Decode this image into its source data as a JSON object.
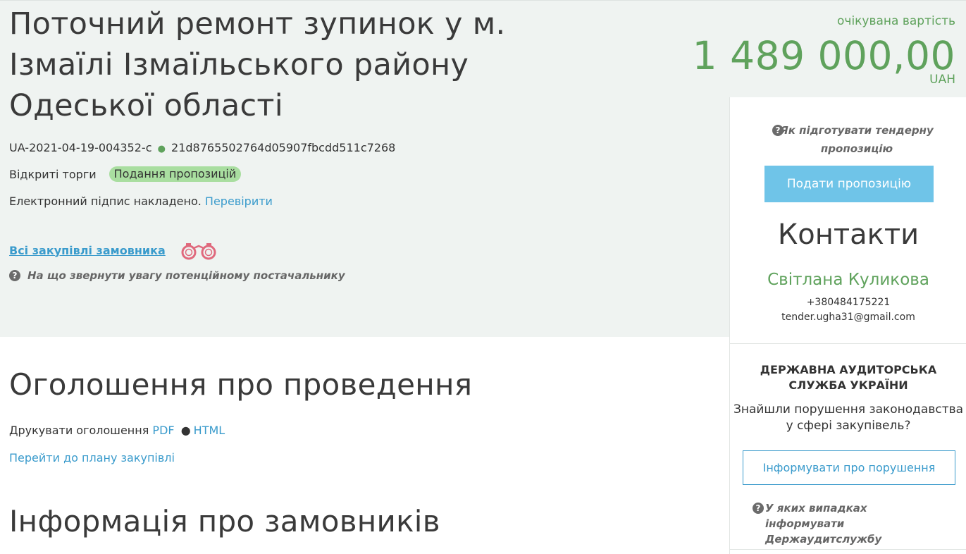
{
  "tender": {
    "title": "Поточний ремонт зупинок у м. Ізмаїлі Ізмаїльського району Одеської області",
    "id": "UA-2021-04-19-004352-c",
    "hash": "21d8765502764d05907fbcdd511c7268",
    "procedure_type": "Відкриті торги",
    "status": "Подання пропозицій",
    "signature_text": "Електронний підпис накладено.",
    "signature_check_link": "Перевірити",
    "all_customer_purchases": "Всі закупівлі замовника",
    "supplier_hint": "На що звернути увагу потенційному постачальнику"
  },
  "price": {
    "label": "очікувана вартість",
    "value": "1 489 000,00",
    "currency": "UAH"
  },
  "sidebar": {
    "prepare_hint": "Як підготувати тендерну пропозицію",
    "submit_button": "Подати пропозицію",
    "contacts_title": "Контакти",
    "contact_name": "Світлана Куликова",
    "contact_phone": "+380484175221",
    "contact_email": "tender.ugha31@gmail.com",
    "audit_title": "ДЕРЖАВНА АУДИТОРСЬКА СЛУЖБА УКРАЇНИ",
    "audit_text": "Знайшли порушення законодавства у сфері закупівель?",
    "report_button": "Інформувати про порушення",
    "audit_hint": "У яких випадках інформувати Держаудитслужбу"
  },
  "announcement": {
    "heading": "Оголошення про проведення",
    "print_label": "Друкувати оголошення",
    "pdf_link": "PDF",
    "html_link": "HTML",
    "plan_link": "Перейти до плану закупівлі"
  },
  "customers": {
    "heading": "Інформація про замовників"
  },
  "icons": {
    "help": "question-circle-icon",
    "binoculars": "binoculars-icon"
  },
  "colors": {
    "accent_green": "#5fa25c",
    "link_blue": "#3a9bcc",
    "button_blue": "#6fc4e8",
    "badge_green": "#a9dea0",
    "band_bg": "#eff3f1"
  }
}
